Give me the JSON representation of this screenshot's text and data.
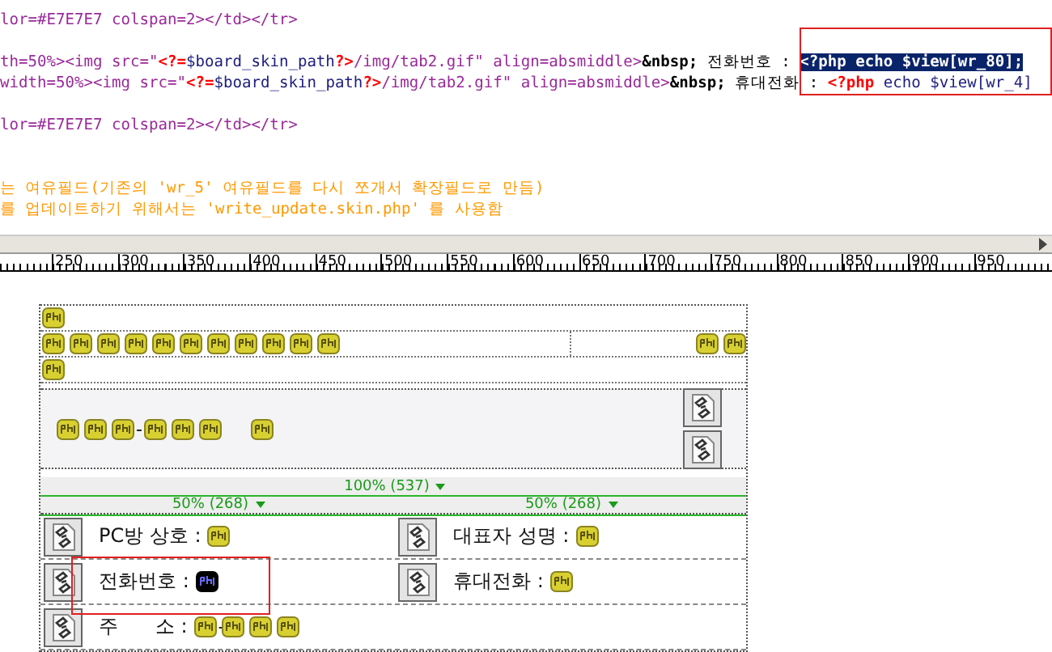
{
  "code_view": {
    "blocks": [
      {
        "lines": [
          [
            {
              "kind": "tag",
              "text": "lor=#E7E7E7 colspan=2></td></tr>"
            }
          ]
        ]
      },
      {
        "lines": [
          [
            {
              "kind": "tag",
              "text": "th=50%><img src=\""
            },
            {
              "kind": "php",
              "text": "<?="
            },
            {
              "kind": "var",
              "text": "$board_skin_path"
            },
            {
              "kind": "php",
              "text": "?>"
            },
            {
              "kind": "tag",
              "text": "/img/tab2.gif\" align=absmiddle>"
            },
            {
              "kind": "entity",
              "text": "&nbsp;"
            },
            {
              "kind": "plain",
              "text": " 전화번호 : "
            },
            {
              "kind": "selected",
              "text": "<?php echo $view[wr_80];"
            }
          ],
          [
            {
              "kind": "tag",
              "text": "width=50%><img src=\""
            },
            {
              "kind": "php",
              "text": "<?="
            },
            {
              "kind": "var",
              "text": "$board_skin_path"
            },
            {
              "kind": "php",
              "text": "?>"
            },
            {
              "kind": "tag",
              "text": "/img/tab2.gif\" align=absmiddle>"
            },
            {
              "kind": "entity",
              "text": "&nbsp;"
            },
            {
              "kind": "plain",
              "text": " 휴대전화 : "
            },
            {
              "kind": "php",
              "text": "<?php"
            },
            {
              "kind": "var",
              "text": " echo $view[wr_4]"
            }
          ]
        ]
      },
      {
        "lines": [
          [
            {
              "kind": "tag",
              "text": "lor=#E7E7E7 colspan=2></td></tr>"
            }
          ]
        ]
      },
      {
        "lines": [
          [
            {
              "kind": "comment",
              "text": "는 여유필드(기존의 'wr_5' 여유필드를 다시 쪼개서 확장필드로 만듬)"
            }
          ],
          [
            {
              "kind": "comment",
              "text": "를 업데이트하기 위해서는 'write_update.skin.php' 를 사용함"
            }
          ]
        ]
      }
    ]
  },
  "ruler": {
    "labels": [
      "250",
      "300",
      "350",
      "400",
      "450",
      "500",
      "550",
      "600",
      "650",
      "700",
      "750",
      "800",
      "850",
      "900",
      "950"
    ]
  },
  "design_view": {
    "top_rows": [
      {
        "left": [
          {
            "kind": "marker"
          }
        ]
      },
      {
        "left": [
          {
            "kind": "marker"
          },
          {
            "kind": "marker"
          },
          {
            "kind": "marker"
          },
          {
            "kind": "marker"
          },
          {
            "kind": "marker"
          },
          {
            "kind": "marker"
          },
          {
            "kind": "marker"
          },
          {
            "kind": "marker"
          },
          {
            "kind": "marker"
          },
          {
            "kind": "marker"
          },
          {
            "kind": "marker"
          }
        ],
        "right": [
          {
            "kind": "marker"
          },
          {
            "kind": "marker"
          }
        ]
      },
      {
        "left": [
          {
            "kind": "marker"
          }
        ]
      }
    ],
    "image_block": {
      "items": [
        {
          "kind": "marker"
        },
        {
          "kind": "marker"
        },
        {
          "kind": "marker"
        },
        {
          "kind": "dash",
          "text": "-"
        },
        {
          "kind": "marker"
        },
        {
          "kind": "marker"
        },
        {
          "kind": "marker"
        },
        {
          "kind": "space"
        },
        {
          "kind": "marker"
        }
      ],
      "side": [
        {
          "kind": "broken_image"
        },
        {
          "kind": "broken_image"
        }
      ]
    },
    "width_guides": {
      "table": "100% (537)",
      "columns": [
        "50% (268)",
        "50% (268)"
      ]
    },
    "field_rows": [
      [
        {
          "label": "PC방 상호 :",
          "items": [
            {
              "kind": "marker",
              "selected": false
            }
          ]
        },
        {
          "label": "대표자 성명 :",
          "items": [
            {
              "kind": "marker",
              "selected": false
            }
          ]
        }
      ],
      [
        {
          "label": "전화번호 :",
          "items": [
            {
              "kind": "marker",
              "selected": true
            }
          ]
        },
        {
          "label": "휴대전화 :",
          "items": [
            {
              "kind": "marker",
              "selected": false
            }
          ]
        }
      ],
      [
        {
          "label": "주      소 :",
          "items": [
            {
              "kind": "marker",
              "selected": false
            },
            {
              "kind": "dash",
              "text": "-"
            },
            {
              "kind": "marker",
              "selected": false
            },
            {
              "kind": "marker",
              "selected": false
            },
            {
              "kind": "marker",
              "selected": false
            }
          ]
        }
      ]
    ]
  }
}
